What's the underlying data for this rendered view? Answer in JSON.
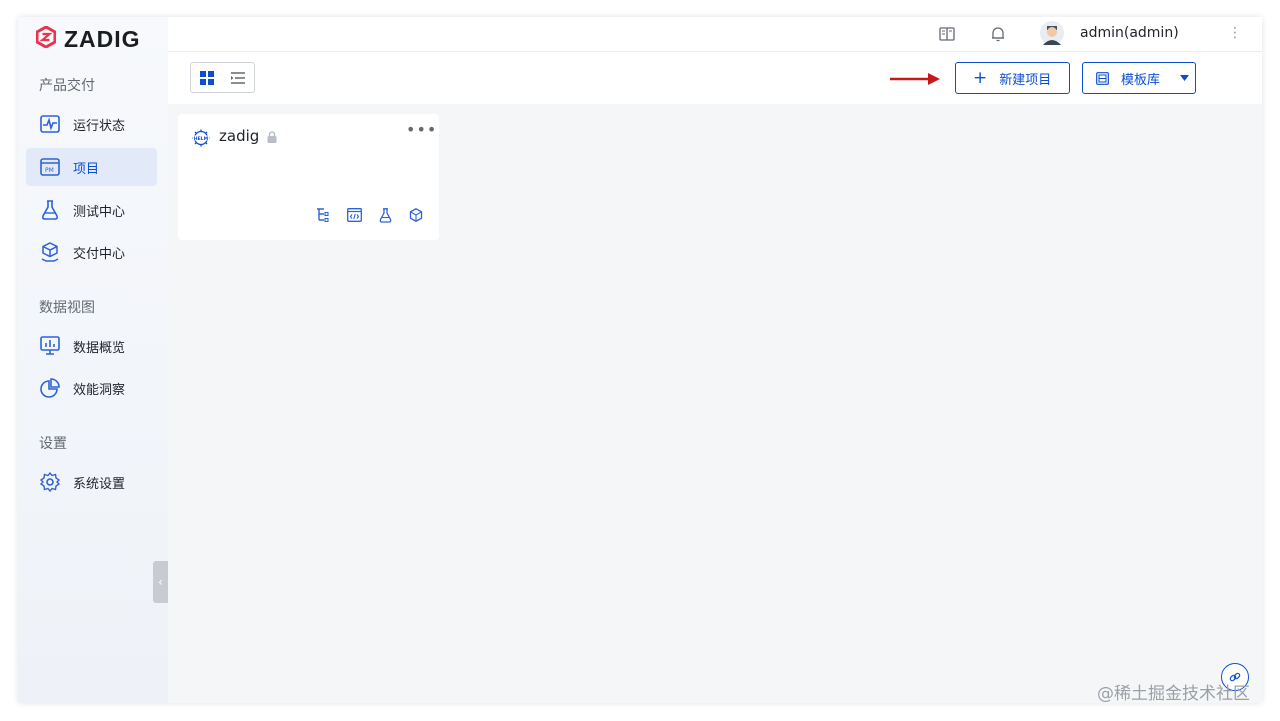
{
  "app": {
    "brand": "ZADIG",
    "brand_color": "#e8344e",
    "accent": "#0c4ecf"
  },
  "sidebar": {
    "sections": [
      {
        "title": "产品交付"
      },
      {
        "title": "数据视图"
      },
      {
        "title": "设置"
      }
    ],
    "items": [
      {
        "label": "运行状态",
        "icon": "pulse-monitor-icon"
      },
      {
        "label": "项目",
        "icon": "project-window-icon",
        "active": true
      },
      {
        "label": "测试中心",
        "icon": "flask-icon"
      },
      {
        "label": "交付中心",
        "icon": "package-hand-icon"
      },
      {
        "label": "数据概览",
        "icon": "chart-monitor-icon"
      },
      {
        "label": "效能洞察",
        "icon": "pie-chart-icon"
      },
      {
        "label": "系统设置",
        "icon": "gear-icon"
      }
    ]
  },
  "header": {
    "username": "admin(admin)"
  },
  "toolbar": {
    "new_project": "新建项目",
    "template_library": "模板库"
  },
  "projects": [
    {
      "name": "zadig",
      "type_badge": "HELM",
      "locked": true
    }
  ],
  "watermark": "@稀土掘金技术社区"
}
